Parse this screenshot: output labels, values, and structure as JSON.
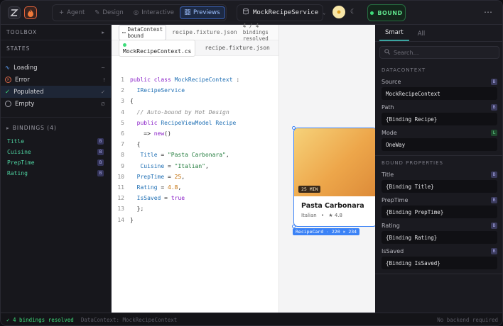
{
  "topbar": {
    "modes": [
      {
        "label": "Agent",
        "icon": "plus-icon"
      },
      {
        "label": "Design",
        "icon": "pen-icon"
      },
      {
        "label": "Interactive",
        "icon": "target-icon"
      },
      {
        "label": "Previews",
        "icon": "grid-icon",
        "active": true
      }
    ],
    "project_name": "MockRecipeService",
    "bound_label": "BOUND"
  },
  "left": {
    "toolbox_label": "TOOLBOX",
    "states_label": "STATES",
    "states": [
      {
        "label": "Loading",
        "tail": "~",
        "icon": "pulse-icon"
      },
      {
        "label": "Error",
        "tail": "!",
        "icon": "error-icon"
      },
      {
        "label": "Populated",
        "tail": "✓",
        "icon": "check-icon",
        "selected": true
      },
      {
        "label": "Empty",
        "tail": "∅",
        "icon": "empty-circle-icon"
      }
    ],
    "bindings_label": "BINDINGS (4)",
    "bindings": [
      {
        "label": "Title",
        "badge": "B"
      },
      {
        "label": "Cuisine",
        "badge": "B"
      },
      {
        "label": "PrepTime",
        "badge": "B"
      },
      {
        "label": "Rating",
        "badge": "B"
      }
    ]
  },
  "editor": {
    "bound_chip": "DataContext bound",
    "header_file": "recipe.fixture.json",
    "resolved": "4 / 4 bindings resolved",
    "tabs": [
      "MockRecipeContext.cs",
      "recipe.fixture.json"
    ]
  },
  "code": [
    "public class MockRecipeContext :",
    "  IRecipeService",
    "{",
    "  // Auto-bound by Hot Design",
    "  public RecipeViewModel Recipe",
    "    => new()",
    "  {",
    "   Title = \"Pasta Carbonara\",",
    "   Cuisine = \"Italian\",",
    "  PrepTime = 25,",
    "  Rating = 4.8,",
    "  IsSaved = true",
    "  };",
    "}"
  ],
  "card": {
    "badge": "25 MIN",
    "title": "Pasta Carbonara",
    "cuisine": "Italian",
    "separator": "•",
    "rating": "★ 4.8",
    "selection_label": "RecipeCard · 220 × 234"
  },
  "right": {
    "tabs": [
      "Smart",
      "All"
    ],
    "search_placeholder": "Search…",
    "datacontext_head": "DATACONTEXT",
    "datacontext": [
      {
        "label": "Source",
        "tag": "B",
        "value": "MockRecipeContext"
      },
      {
        "label": "Path",
        "tag": "B",
        "value": "{Binding Recipe}"
      },
      {
        "label": "Mode",
        "tag": "L",
        "value": "OneWay"
      }
    ],
    "bound_head": "BOUND PROPERTIES",
    "bound": [
      {
        "label": "Title",
        "tag": "B",
        "value": "{Binding Title}"
      },
      {
        "label": "PrepTime",
        "tag": "B",
        "value": "{Binding PrepTime}"
      },
      {
        "label": "Rating",
        "tag": "B",
        "value": "{Binding Rating}"
      },
      {
        "label": "IsSaved",
        "tag": "B",
        "value": "{Binding IsSaved}"
      }
    ]
  },
  "status": {
    "resolved": "✓ 4 bindings resolved",
    "datacontext": "DataContext: MockRecipeContext",
    "backend": "No backend required"
  },
  "colors": {
    "accent": "#3b82f6",
    "bound_green": "#3ddc7a",
    "binding_text": "#4ed2a0"
  }
}
